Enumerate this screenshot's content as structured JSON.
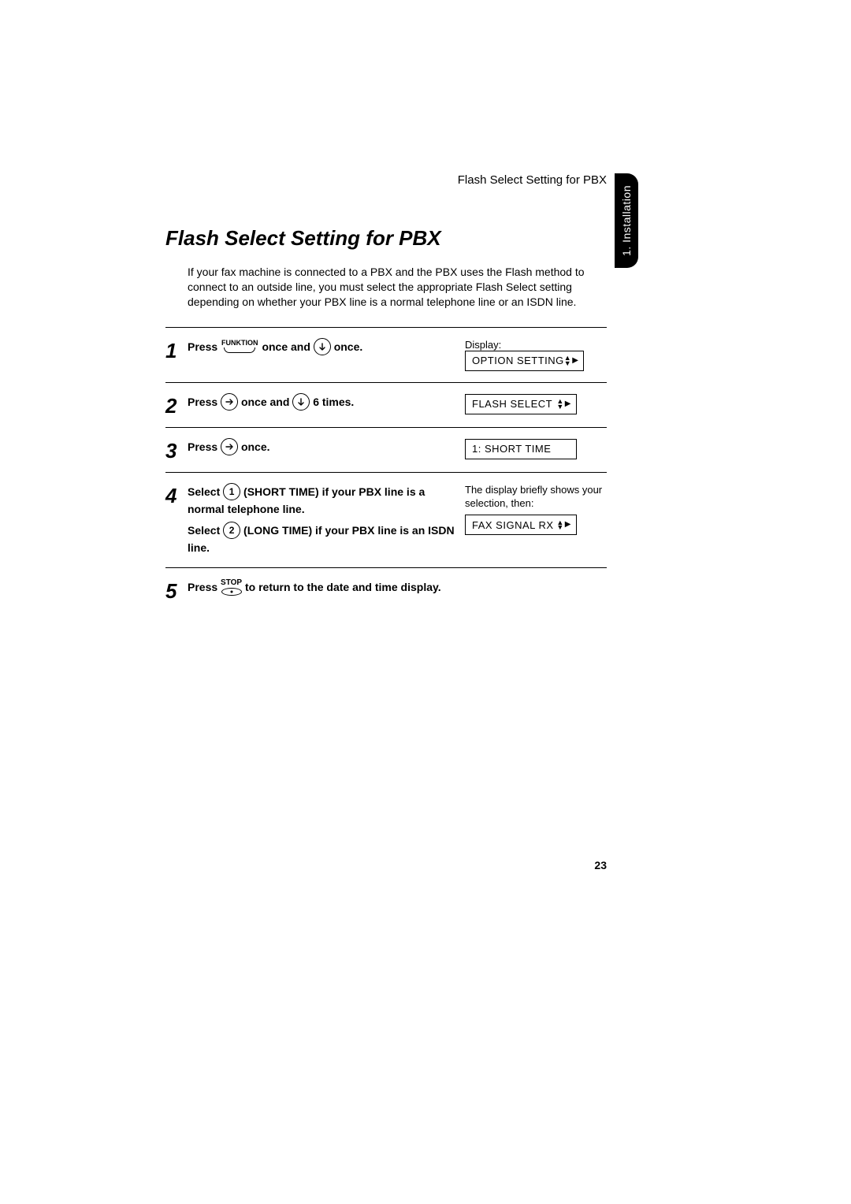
{
  "running_head": "Flash Select Setting for PBX",
  "side_tab": "1. Installation",
  "title": "Flash Select Setting for PBX",
  "intro": "If your fax machine is connected to a PBX and the PBX uses the   Flash method to connect to an outside line, you must select the appropriate Flash Select setting depending on whether your PBX line is a normal telephone line or an ISDN line.",
  "keys": {
    "funktion": "FUNKTION",
    "stop": "STOP",
    "digit1": "1",
    "digit2": "2"
  },
  "display_label": "Display:",
  "steps": {
    "s1": {
      "num": "1",
      "t1": "Press ",
      "t2": " once and ",
      "t3": " once.",
      "lcd": "OPTION SETTING"
    },
    "s2": {
      "num": "2",
      "t1": "Press ",
      "t2": " once and ",
      "t3": " 6 times.",
      "lcd": "FLASH SELECT"
    },
    "s3": {
      "num": "3",
      "t1": "Press ",
      "t2": " once.",
      "lcd": "1: SHORT TIME"
    },
    "s4": {
      "num": "4",
      "a1": "Select ",
      "a2": " (SHORT TIME) if your PBX line is a normal telephone line.",
      "b1": "Select ",
      "b2": " (LONG TIME) if your PBX line is an ISDN line.",
      "note": "The display briefly shows your selection, then:",
      "lcd": "FAX SIGNAL RX"
    },
    "s5": {
      "num": "5",
      "t1": "Press ",
      "t2": " to return to the date and time display."
    }
  },
  "page_number": "23"
}
